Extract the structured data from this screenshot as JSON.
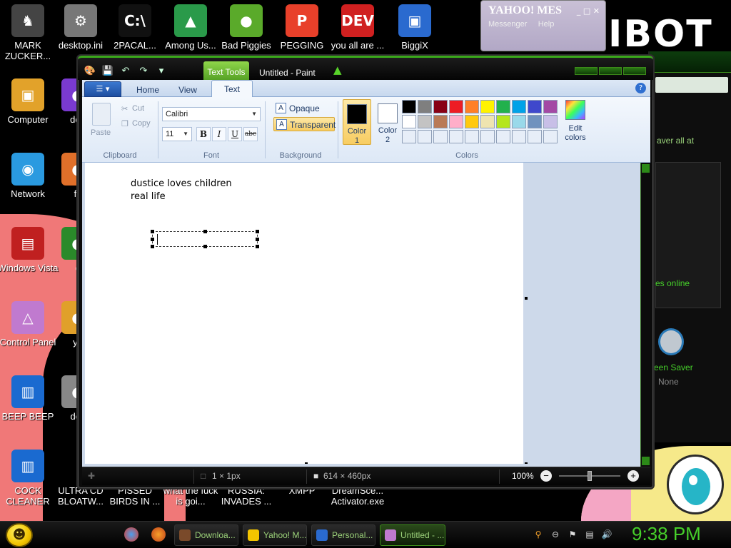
{
  "desktop": {
    "brand_text": "IBOT",
    "icons": [
      {
        "label": "MARK ZUCKER...",
        "glyph": "♞",
        "color": "#444"
      },
      {
        "label": "desktop.ini",
        "glyph": "⚙",
        "color": "#777"
      },
      {
        "label": "2PACAL...",
        "glyph": "C:\\",
        "color": "#111"
      },
      {
        "label": "Among Us...",
        "glyph": "▲",
        "color": "#2a9a4a"
      },
      {
        "label": "Bad Piggies",
        "glyph": "●",
        "color": "#5aaa2a"
      },
      {
        "label": "PEGGING",
        "glyph": "P",
        "color": "#e8402a"
      },
      {
        "label": "you all are ...",
        "glyph": "DEV",
        "color": "#d02020"
      },
      {
        "label": "BiggiX",
        "glyph": "▣",
        "color": "#2a6acf"
      },
      {
        "label": "Computer",
        "glyph": "▣",
        "color": "#e2a22a"
      },
      {
        "label": "doe",
        "glyph": "●",
        "color": "#7a3ad0"
      },
      {
        "label": "Network",
        "glyph": "◉",
        "color": "#2a9ae0"
      },
      {
        "label": "fu",
        "glyph": "●",
        "color": "#e0702a"
      },
      {
        "label": "Windows Vista",
        "glyph": "▤",
        "color": "#c02020"
      },
      {
        "label": "c",
        "glyph": "●",
        "color": "#2a8a2a"
      },
      {
        "label": "Control Panel",
        "glyph": "△",
        "color": "#c07acf"
      },
      {
        "label": "yo",
        "glyph": "●",
        "color": "#e0a02a"
      },
      {
        "label": "BEEP BEEP",
        "glyph": "▥",
        "color": "#1a6ad0"
      },
      {
        "label": "des",
        "glyph": "●",
        "color": "#888"
      },
      {
        "label": "COCK CLEANER",
        "glyph": "▥",
        "color": "#1a6ad0"
      },
      {
        "label": "ULTRA CD BLOATW...",
        "glyph": "",
        "color": "transparent"
      },
      {
        "label": "PISSED BIRDS IN ...",
        "glyph": "",
        "color": "transparent"
      },
      {
        "label": "what the fuck is goi...",
        "glyph": "",
        "color": "transparent"
      },
      {
        "label": "RUSSIA: INVADES ...",
        "glyph": "",
        "color": "transparent"
      },
      {
        "label": "XMPP",
        "glyph": "",
        "color": "transparent"
      },
      {
        "label": "DreamSce... Activator.exe",
        "glyph": "",
        "color": "transparent"
      }
    ]
  },
  "yahoo_window": {
    "title": "YAHOO! MES",
    "menu1": "Messenger",
    "menu2": "Help",
    "controls": "_ □ ✕"
  },
  "right_window": {
    "text1": "aver all at",
    "text2": "es online",
    "text3": "een Saver",
    "text4": "None"
  },
  "paint": {
    "window_title": "Untitled - Paint",
    "context_tab": "Text Tools",
    "tabs": {
      "home": "Home",
      "view": "View",
      "text": "Text"
    },
    "clipboard": {
      "paste": "Paste",
      "cut": "Cut",
      "copy": "Copy",
      "group": "Clipboard"
    },
    "font": {
      "family": "Calibri",
      "size": "11",
      "bold": "B",
      "italic": "I",
      "underline": "U",
      "strike": "abc",
      "group": "Font"
    },
    "background": {
      "opaque": "Opaque",
      "transparent": "Transparent",
      "group": "Background"
    },
    "colors": {
      "color1_label": "Color",
      "color1_num": "1",
      "color2_label": "Color",
      "color2_num": "2",
      "edit_label": "Edit",
      "edit_label2": "colors",
      "group": "Colors",
      "color1": "#000000",
      "color2": "#ffffff",
      "palette": [
        "#000000",
        "#7f7f7f",
        "#880015",
        "#ed1c24",
        "#ff7f27",
        "#fff200",
        "#22b14c",
        "#00a2e8",
        "#3f48cc",
        "#a349a4",
        "#ffffff",
        "#c3c3c3",
        "#b97a57",
        "#ffaec9",
        "#ffc90e",
        "#efe4b0",
        "#b5e61d",
        "#99d9ea",
        "#7092be",
        "#c8bfe7",
        "#e7eef8",
        "#e7eef8",
        "#e7eef8",
        "#e7eef8",
        "#e7eef8",
        "#e7eef8",
        "#e7eef8",
        "#e7eef8",
        "#e7eef8",
        "#e7eef8"
      ]
    },
    "canvas_text": [
      "dustice loves children",
      "real life"
    ],
    "status": {
      "cursor": "1 × 1px",
      "size": "614 × 460px",
      "zoom": "100%"
    }
  },
  "taskbar": {
    "buttons": [
      {
        "label": "Downloa...",
        "color": "#7a4a2a"
      },
      {
        "label": "Yahoo! M...",
        "color": "#f3c400"
      },
      {
        "label": "Personal...",
        "color": "#2a6acf"
      },
      {
        "label": "Untitled - ...",
        "color": "#c07acf"
      }
    ],
    "clock": "9:38 PM"
  }
}
